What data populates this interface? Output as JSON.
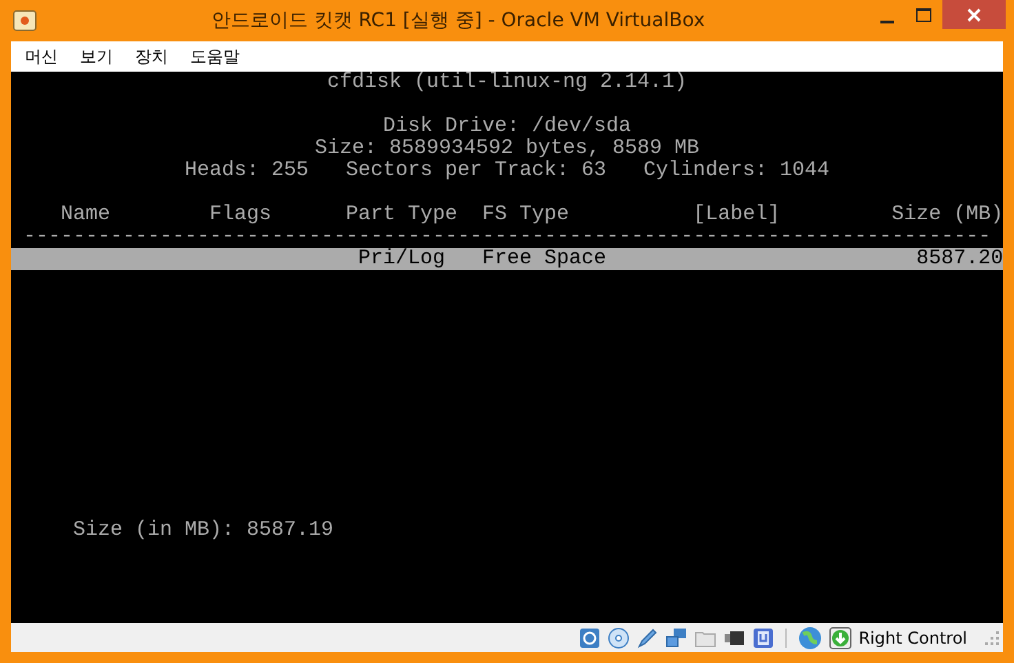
{
  "window": {
    "title": "안드로이드 킷캣 RC1 [실행 중] - Oracle VM VirtualBox"
  },
  "menu": [
    "머신",
    "보기",
    "장치",
    "도움말"
  ],
  "terminal": {
    "title": "cfdisk (util-linux-ng 2.14.1)",
    "disk_info": [
      "Disk Drive: /dev/sda",
      "Size: 8589934592 bytes, 8589 MB",
      "Heads: 255   Sectors per Track: 63   Cylinders: 1044"
    ],
    "columns": [
      "Name",
      "Flags",
      "Part Type",
      "FS Type",
      "[Label]",
      "Size (MB)"
    ],
    "separator": "------------------------------------------------------------------------------",
    "rows": [
      {
        "selected": true,
        "cells": [
          "",
          "",
          "Pri/Log",
          "Free Space",
          "",
          "8587.20"
        ]
      }
    ],
    "prompt": {
      "label": "Size (in MB):",
      "value": "8587.19"
    }
  },
  "status_bar": {
    "host_key": "Right Control"
  }
}
